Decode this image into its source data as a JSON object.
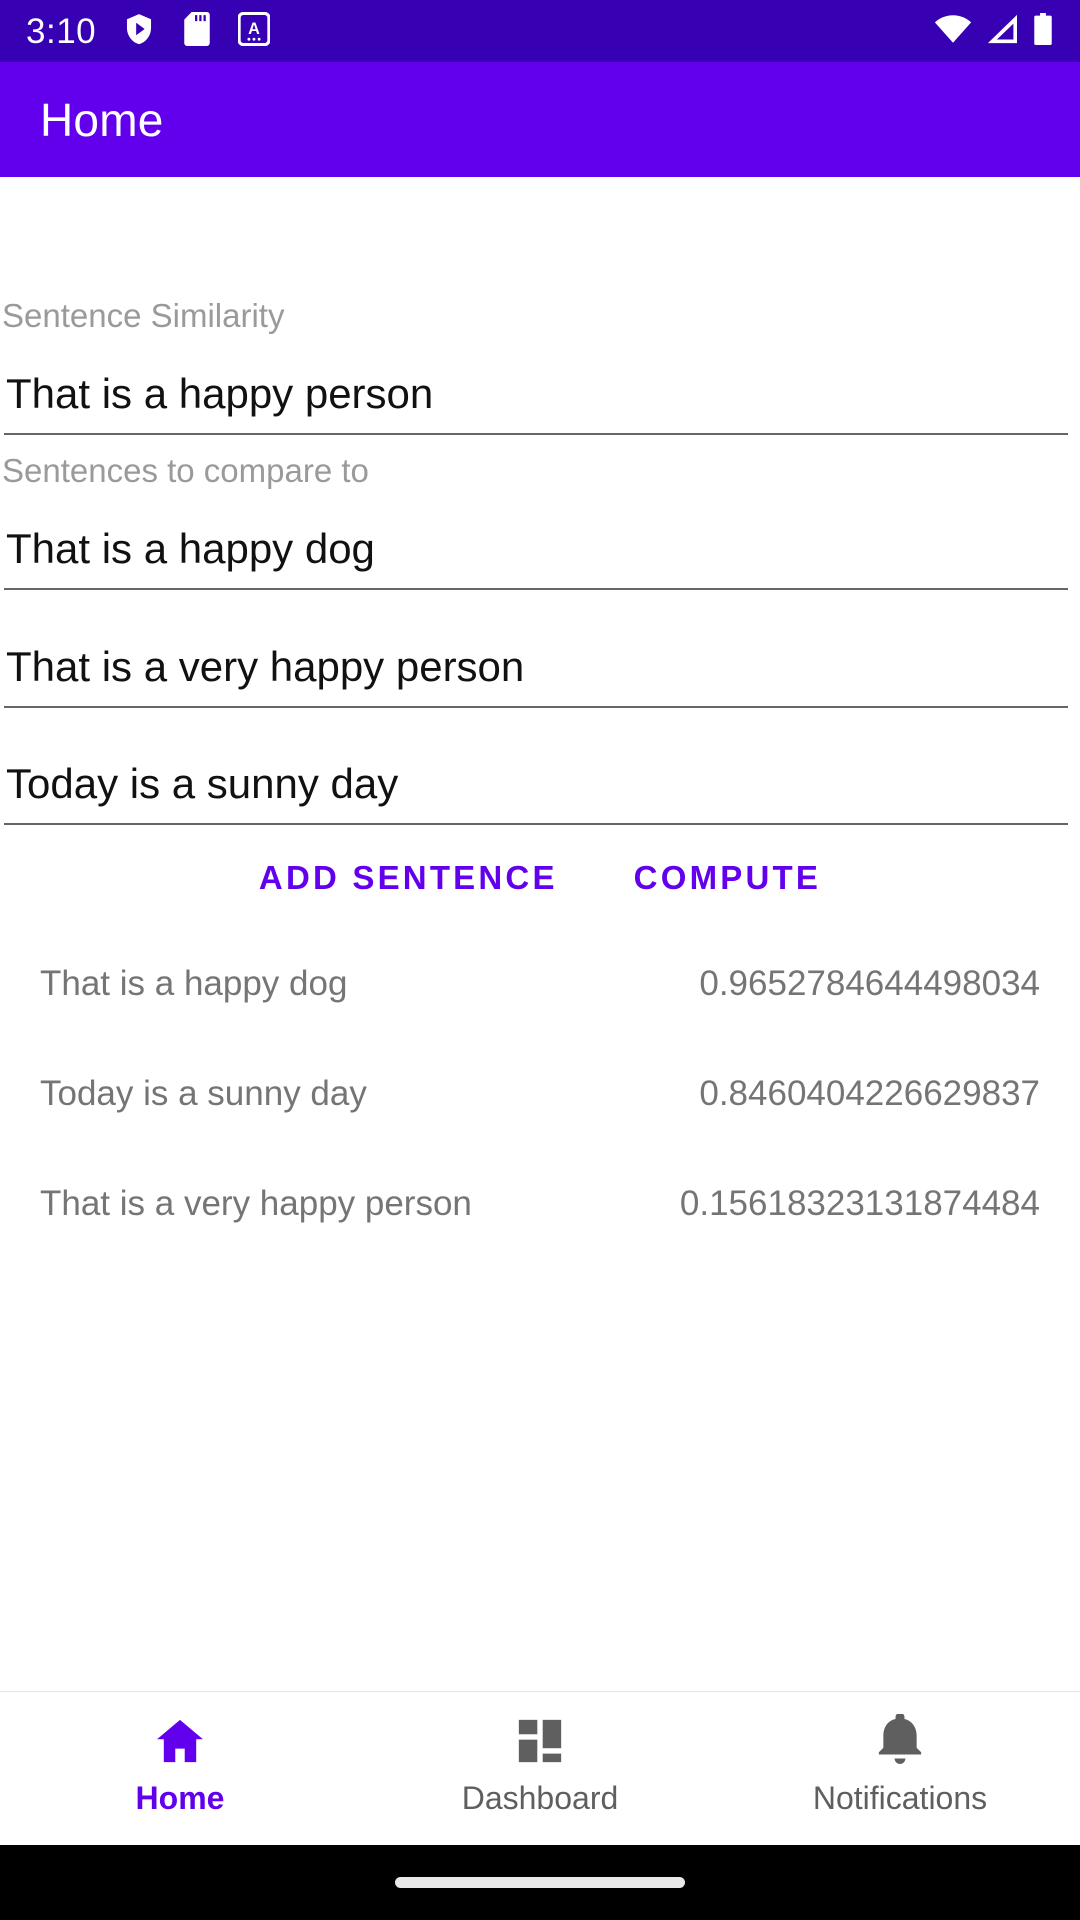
{
  "status_bar": {
    "time": "3:10",
    "left_icons": [
      "play-protect-shield-icon",
      "sd-card-icon",
      "android-auto-icon"
    ],
    "right_icons": [
      "wifi-icon",
      "cellular-signal-icon",
      "battery-icon"
    ],
    "background": "#3700B3"
  },
  "app_bar": {
    "title": "Home",
    "background": "#6200EE",
    "text_color": "#FFFFFF"
  },
  "form": {
    "primary_label": "Sentence Similarity",
    "primary_value": "That is a happy person",
    "compare_label": "Sentences to compare to",
    "compare_values": [
      "That is a happy dog",
      "That is a very happy person",
      "Today is a sunny day"
    ]
  },
  "actions": {
    "add_sentence": "ADD SENTENCE",
    "compute": "COMPUTE",
    "accent": "#6200EE"
  },
  "results": [
    {
      "sentence": "That is a happy dog",
      "score": "0.9652784644498034"
    },
    {
      "sentence": "Today is a sunny day",
      "score": "0.8460404226629837"
    },
    {
      "sentence": "That is a very happy person",
      "score": "0.15618323131874484"
    }
  ],
  "bottom_nav": {
    "active_color": "#6200EE",
    "inactive_color": "#5F5F5F",
    "items": [
      {
        "label": "Home",
        "icon": "home-icon",
        "active": true
      },
      {
        "label": "Dashboard",
        "icon": "dashboard-icon",
        "active": false
      },
      {
        "label": "Notifications",
        "icon": "bell-icon",
        "active": false
      }
    ]
  }
}
